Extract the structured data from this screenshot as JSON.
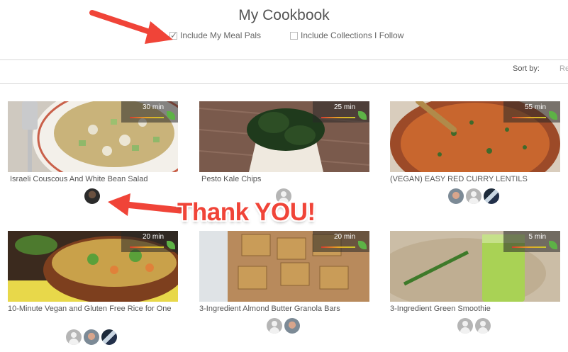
{
  "page": {
    "title": "My Cookbook"
  },
  "filters": {
    "meal_pals": {
      "label": "Include My Meal Pals",
      "checked": true
    },
    "collections": {
      "label": "Include Collections I Follow",
      "checked": false
    }
  },
  "sort": {
    "label": "Sort by:",
    "value": "Re"
  },
  "annotation": {
    "text": "Thank YOU!",
    "color": "#f04438"
  },
  "recipes": [
    {
      "name": "Israeli Couscous And White Bean Salad",
      "time": "30 min",
      "avatars": [
        "photo-avatar"
      ]
    },
    {
      "name": "Pesto Kale Chips",
      "time": "25 min",
      "avatars": [
        "default-avatar"
      ]
    },
    {
      "name": "(VEGAN) EASY RED CURRY LENTILS",
      "time": "55 min",
      "avatars": [
        "photo-avatar",
        "default-avatar",
        "photo-avatar"
      ]
    },
    {
      "name": "10-Minute Vegan and Gluten Free Rice for One",
      "time": "20 min",
      "avatars": [
        "default-avatar",
        "photo-avatar",
        "photo-avatar"
      ]
    },
    {
      "name": "3-Ingredient Almond Butter Granola Bars",
      "time": "20 min",
      "avatars": [
        "default-avatar",
        "photo-avatar"
      ]
    },
    {
      "name": "3-Ingredient Green Smoothie",
      "time": "5 min",
      "avatars": [
        "default-avatar",
        "default-avatar"
      ]
    }
  ]
}
